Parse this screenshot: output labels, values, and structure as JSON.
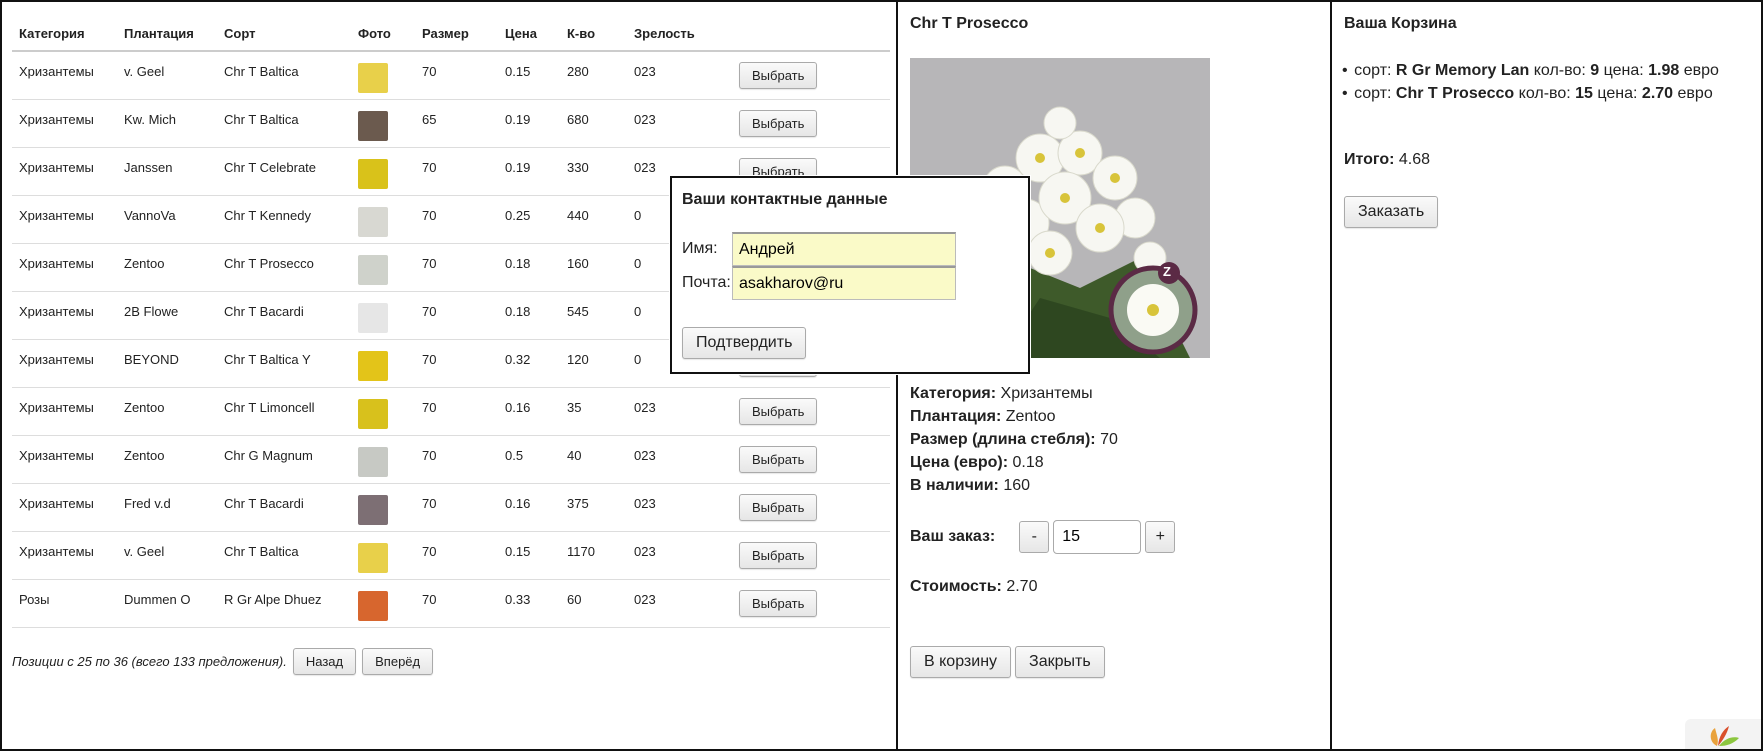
{
  "table": {
    "headers": [
      "Категория",
      "Плантация",
      "Сорт",
      "Фото",
      "Размер",
      "Цена",
      "К-во",
      "Зрелость"
    ],
    "select_label": "Выбрать",
    "rows": [
      {
        "category": "Хризантемы",
        "plantation": "v. Geel",
        "variety": "Chr T Baltica",
        "size": "70",
        "price": "0.15",
        "qty": "280",
        "ripeness": "023"
      },
      {
        "category": "Хризантемы",
        "plantation": "Kw. Mich",
        "variety": "Chr T Baltica",
        "size": "65",
        "price": "0.19",
        "qty": "680",
        "ripeness": "023"
      },
      {
        "category": "Хризантемы",
        "plantation": "Janssen",
        "variety": "Chr T Celebrate",
        "size": "70",
        "price": "0.19",
        "qty": "330",
        "ripeness": "023"
      },
      {
        "category": "Хризантемы",
        "plantation": "VannoVa",
        "variety": "Chr T Kennedy",
        "size": "70",
        "price": "0.25",
        "qty": "440",
        "ripeness": "0"
      },
      {
        "category": "Хризантемы",
        "plantation": "Zentoo",
        "variety": "Chr T Prosecco",
        "size": "70",
        "price": "0.18",
        "qty": "160",
        "ripeness": "0"
      },
      {
        "category": "Хризантемы",
        "plantation": "2B Flowe",
        "variety": "Chr T Bacardi",
        "size": "70",
        "price": "0.18",
        "qty": "545",
        "ripeness": "0"
      },
      {
        "category": "Хризантемы",
        "plantation": "BEYOND",
        "variety": "Chr T Baltica Y",
        "size": "70",
        "price": "0.32",
        "qty": "120",
        "ripeness": "0"
      },
      {
        "category": "Хризантемы",
        "plantation": "Zentoo",
        "variety": "Chr T Limoncell",
        "size": "70",
        "price": "0.16",
        "qty": "35",
        "ripeness": "023"
      },
      {
        "category": "Хризантемы",
        "plantation": "Zentoo",
        "variety": "Chr G Magnum",
        "size": "70",
        "price": "0.5",
        "qty": "40",
        "ripeness": "023"
      },
      {
        "category": "Хризантемы",
        "plantation": "Fred v.d",
        "variety": "Chr T Bacardi",
        "size": "70",
        "price": "0.16",
        "qty": "375",
        "ripeness": "023"
      },
      {
        "category": "Хризантемы",
        "plantation": "v. Geel",
        "variety": "Chr T Baltica",
        "size": "70",
        "price": "0.15",
        "qty": "1170",
        "ripeness": "023"
      },
      {
        "category": "Розы",
        "plantation": "Dummen O",
        "variety": "R Gr Alpe Dhuez",
        "size": "70",
        "price": "0.33",
        "qty": "60",
        "ripeness": "023"
      }
    ],
    "thumb_colors": [
      "#e8d04a",
      "#6b5a4e",
      "#d9c21a",
      "#d8d8d2",
      "#cfd2cb",
      "#e6e6e6",
      "#e3c419",
      "#d8c11c",
      "#c7c9c4",
      "#7d6f74",
      "#e8d04a",
      "#d7662e"
    ]
  },
  "pager": {
    "text": "Позиции с 25 по 36 (всего 133 предложения).",
    "prev": "Назад",
    "next": "Вперёд"
  },
  "detail": {
    "title": "Chr T Prosecco",
    "category_label": "Категория:",
    "category": "Хризантемы",
    "plantation_label": "Плантация:",
    "plantation": "Zentoo",
    "size_label": "Размер (длина стебля):",
    "size": "70",
    "price_label": "Цена (евро):",
    "price": "0.18",
    "stock_label": "В наличии:",
    "stock": "160",
    "order_label": "Ваш заказ:",
    "minus": "-",
    "plus": "+",
    "qty": "15",
    "cost_label": "Стоимость:",
    "cost": "2.70",
    "add_to_cart": "В корзину",
    "close": "Закрыть",
    "badge": "Z"
  },
  "cart": {
    "title": "Ваша Корзина",
    "items": [
      {
        "pre": "сорт:",
        "name": "R Gr Memory Lan",
        "qty_label": "кол-во:",
        "qty": "9",
        "price_label": "цена:",
        "price": "1.98",
        "currency": "евро"
      },
      {
        "pre": "сорт:",
        "name": "Chr T Prosecco",
        "qty_label": "кол-во:",
        "qty": "15",
        "price_label": "цена:",
        "price": "2.70",
        "currency": "евро"
      }
    ],
    "total_label": "Итого:",
    "total": "4.68",
    "order_button": "Заказать"
  },
  "modal": {
    "title": "Ваши контактные данные",
    "name_label": "Имя:",
    "name_value": "Андрей",
    "email_label": "Почта:",
    "email_value": "asakharov@ru",
    "confirm": "Подтвердить"
  }
}
